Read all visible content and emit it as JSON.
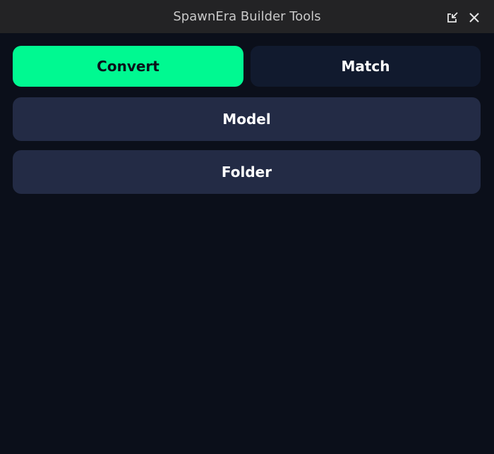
{
  "window": {
    "title": "SpawnEra Builder Tools",
    "dock_icon": "dock-toggle-icon",
    "close_icon": "close-icon"
  },
  "tabs": [
    {
      "label": "Convert",
      "active": true
    },
    {
      "label": "Match",
      "active": false
    }
  ],
  "options": [
    {
      "label": "Model"
    },
    {
      "label": "Folder"
    }
  ],
  "colors": {
    "accent": "#00f991",
    "background": "#0b0f1a",
    "titlebar": "#232325",
    "inactive_tab": "#111a2e",
    "option_button": "#232b45"
  }
}
